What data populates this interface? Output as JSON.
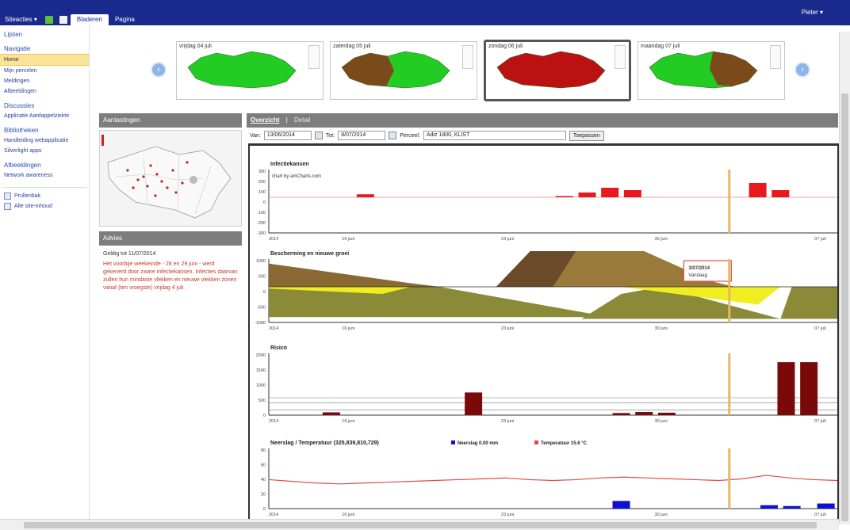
{
  "header": {
    "site_actions": "Siteacties ▾",
    "tabs": [
      {
        "label": "Bladeren",
        "active": true
      },
      {
        "label": "Pagina",
        "active": false
      }
    ],
    "user": "Pieter ▾"
  },
  "nav": {
    "items": [
      {
        "label": "Lijsten",
        "type": "head"
      },
      {
        "label": "Navigatie",
        "type": "head"
      },
      {
        "label": "Home",
        "type": "selected"
      },
      {
        "label": "Mijn percelen",
        "type": "item"
      },
      {
        "label": "Meldingen",
        "type": "item"
      },
      {
        "label": "Afbeeldingen",
        "type": "item"
      },
      {
        "label": "Discussies",
        "type": "head"
      },
      {
        "label": "Applicatie Aardappelziekte",
        "type": "item"
      },
      {
        "label": "Bibliotheken",
        "type": "head"
      },
      {
        "label": "Handleiding webapplicatie",
        "type": "item"
      },
      {
        "label": "Silverlight apps",
        "type": "item"
      },
      {
        "label": "Afbeeldingen",
        "type": "head"
      },
      {
        "label": "Network awareness",
        "type": "item"
      }
    ],
    "utilities": [
      {
        "label": "Prullenbak"
      },
      {
        "label": "Alle site-inhoud"
      }
    ]
  },
  "thumbnails": [
    {
      "label": "vrijdag 04 juli",
      "map_color": "#22cc22",
      "overlay_color": "",
      "selected": false
    },
    {
      "label": "zaterdag 05 juli",
      "map_color": "#22cc22",
      "overlay_color": "#7a4a1a",
      "selected": false
    },
    {
      "label": "zondag 06 juli",
      "map_color": "#bb1111",
      "overlay_color": "",
      "selected": true
    },
    {
      "label": "maandag 07 juli",
      "map_color": "#22cc22",
      "overlay_color": "#7a4a1a",
      "selected": false
    }
  ],
  "panels": {
    "warnings_title": "Aantastingen",
    "advice_title": "Advies",
    "advice_date": "Geldig tot 11/07/2014",
    "advice_text": "Het voorbije weekeinde - 28 en 29 juni - werd gekenerd door zware infectiekansen. Infecties daarvan zullen hun mindaste vlekken en nieuwe vlekken zonen vanaf (ten vroegste) vrijdag 4 juli."
  },
  "main": {
    "tab_active": "Overzicht",
    "tab_inactive": "Detail",
    "from_label": "Van:",
    "from_value": "13/06/2014",
    "to_label": "Tot:",
    "to_value": "8/07/2014",
    "parcel_label": "Perceel:",
    "parcel_value": "Adiz 1800, KLIST",
    "show_button": "Toepassen"
  },
  "colors": {
    "header_bg": "#1a2a8c",
    "infection": "#e8191e",
    "rain": "#7a0a0a",
    "temp_line": "#e84848",
    "precip_bar": "#1010d0",
    "marker": "#e8b860"
  },
  "chart_data": [
    {
      "type": "bar",
      "title": "Infectiekansen",
      "subtitle": "chart by amCharts.com",
      "x_tick_labels": [
        "2014",
        "16 juni",
        "23 juni",
        "30 juni",
        "07 juli"
      ],
      "y_tick_labels": [
        "300",
        "200",
        "100",
        "0",
        "-100",
        "-200",
        "-300"
      ],
      "ylim": [
        -300,
        300
      ],
      "bars": [
        {
          "x": 0.17,
          "value": 25
        },
        {
          "x": 0.52,
          "value": 10
        },
        {
          "x": 0.56,
          "value": 40
        },
        {
          "x": 0.6,
          "value": 80
        },
        {
          "x": 0.64,
          "value": 60
        },
        {
          "x": 0.86,
          "value": 120
        },
        {
          "x": 0.9,
          "value": 60
        }
      ]
    },
    {
      "type": "area",
      "title": "Bescherming en nieuwe groei",
      "x_tick_labels": [
        "2014",
        "16 juni",
        "23 juni",
        "30 juni",
        "07 juli"
      ],
      "y_tick_labels": [
        "1000",
        "500",
        "0",
        "-500",
        "-1000"
      ],
      "ylim": [
        -1000,
        1000
      ],
      "tooltip_date": "3/07/2014",
      "tooltip_day": "Vandaag"
    },
    {
      "type": "bar",
      "title": "Risico",
      "x_tick_labels": [
        "2014",
        "16 juni",
        "23 juni",
        "30 juni",
        "07 juli"
      ],
      "y_tick_labels": [
        "2000",
        "1500",
        "1000",
        "500",
        "0"
      ],
      "ylim": [
        0,
        2000
      ],
      "bars": [
        {
          "x": 0.11,
          "value": 80
        },
        {
          "x": 0.36,
          "value": 650
        },
        {
          "x": 0.62,
          "value": 60
        },
        {
          "x": 0.66,
          "value": 90
        },
        {
          "x": 0.7,
          "value": 70
        },
        {
          "x": 0.91,
          "value": 1520
        },
        {
          "x": 0.95,
          "value": 1520
        }
      ]
    },
    {
      "type": "line",
      "title": "Neerslag / Temperatuur (325,839,810,729)",
      "legend": [
        {
          "name": "Neerslag 0.00 mm",
          "color": "#1010d0"
        },
        {
          "name": "Temperatuur 15.6 °C",
          "color": "#e84848"
        }
      ],
      "x_tick_labels": [
        "2014",
        "16 juni",
        "23 juni",
        "30 juni",
        "07 juli"
      ],
      "y_tick_labels": [
        "80",
        "60",
        "40",
        "20",
        "0"
      ],
      "ylim": [
        0,
        80
      ],
      "temperature": [
        34,
        32,
        30,
        29,
        30,
        31,
        32,
        33,
        34,
        35,
        36,
        34,
        33,
        34,
        36,
        37,
        36,
        35,
        34,
        33,
        35,
        39,
        36,
        34,
        33
      ],
      "precip_bars": [
        {
          "x": 0.62,
          "value": 9
        },
        {
          "x": 0.88,
          "value": 4
        },
        {
          "x": 0.92,
          "value": 3
        },
        {
          "x": 0.98,
          "value": 6
        }
      ]
    }
  ]
}
